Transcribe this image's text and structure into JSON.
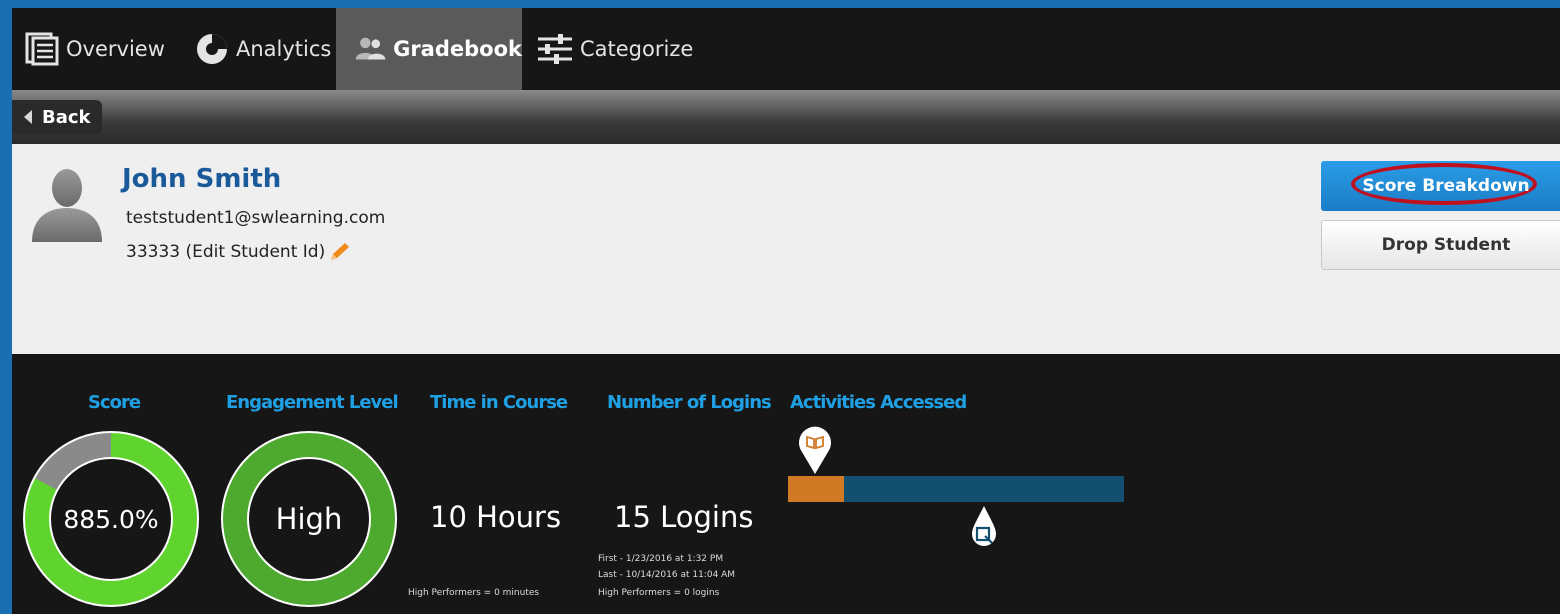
{
  "nav": {
    "tabs": [
      {
        "label": "Overview",
        "icon": "document-icon"
      },
      {
        "label": "Analytics",
        "icon": "pie-icon"
      },
      {
        "label": "Gradebook",
        "icon": "users-icon"
      },
      {
        "label": "Categorize",
        "icon": "sliders-icon"
      }
    ]
  },
  "back": {
    "label": "Back"
  },
  "student": {
    "name": "John Smith",
    "email": "teststudent1@swlearning.com",
    "id_text": "33333 (Edit Student Id)"
  },
  "buttons": {
    "score_breakdown": "Score Breakdown",
    "drop_student": "Drop Student"
  },
  "stats": {
    "score": {
      "label": "Score",
      "value": "885.0%"
    },
    "engagement": {
      "label": "Engagement Level",
      "value": "High"
    },
    "time": {
      "label": "Time in Course",
      "value": "10 Hours",
      "note": "High Performers = 0 minutes"
    },
    "logins": {
      "label": "Number of Logins",
      "value": "15 Logins",
      "first": "First - 1/23/2016 at 1:32 PM",
      "last": "Last - 10/14/2016 at 11:04 AM",
      "note": "High Performers = 0 logins"
    },
    "activities": {
      "label": "Activities Accessed"
    }
  },
  "colors": {
    "accent": "#1fa0e4",
    "score_green": "#5fd32e",
    "engage_green": "#4daa2e",
    "activity_orange": "#d07a26",
    "activity_blue": "#13506f"
  }
}
